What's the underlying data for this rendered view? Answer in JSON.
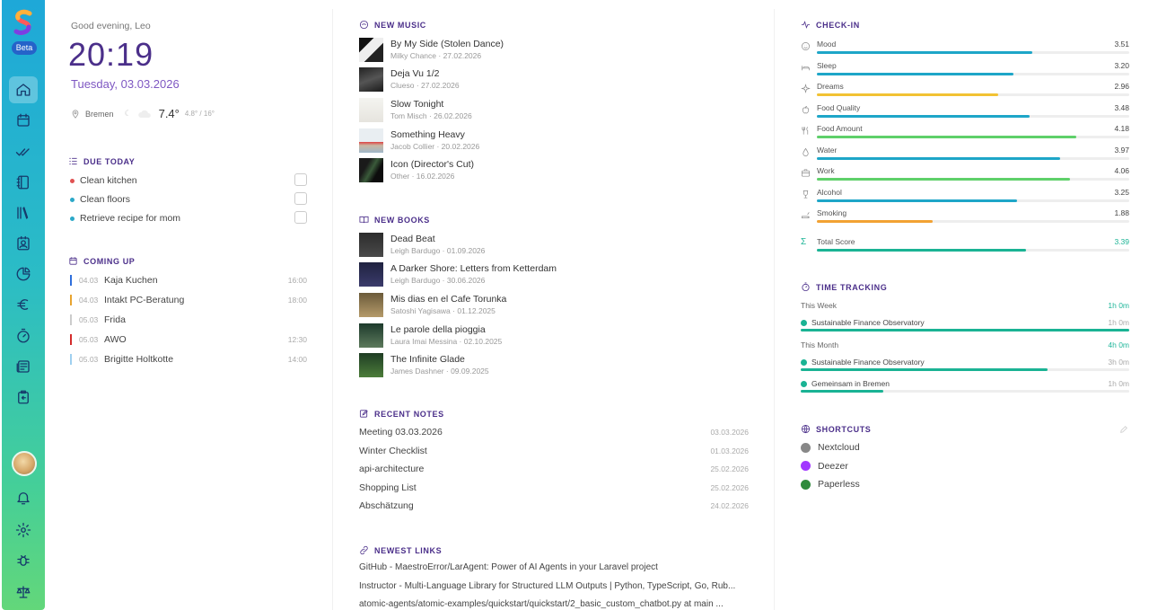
{
  "sidebar": {
    "beta": "Beta",
    "nav": [
      "home-icon",
      "calendar-icon",
      "double-check-icon",
      "notebook-icon",
      "library-icon",
      "contact-icon",
      "chart-icon",
      "euro-icon",
      "timer-icon",
      "news-icon",
      "clipboard-icon"
    ],
    "bottom": [
      "bell-icon",
      "gear-icon",
      "bug-icon",
      "scale-icon"
    ]
  },
  "header": {
    "greeting": "Good evening, Leo",
    "time": "20:19",
    "date": "Tuesday, 03.03.2026",
    "weather": {
      "city": "Bremen",
      "temp": "7.4°",
      "range": "4.8° / 16°"
    }
  },
  "due_today": {
    "title": "DUE TODAY",
    "tasks": [
      {
        "label": "Clean kitchen",
        "color": "#e05252"
      },
      {
        "label": "Clean floors",
        "color": "#2ba8c8"
      },
      {
        "label": "Retrieve recipe for mom",
        "color": "#2ba8c8"
      }
    ]
  },
  "coming_up": {
    "title": "COMING UP",
    "events": [
      {
        "date": "04.03",
        "label": "Kaja Kuchen",
        "time": "16:00",
        "color": "#2f6fdc"
      },
      {
        "date": "04.03",
        "label": "Intakt PC-Beratung",
        "time": "18:00",
        "color": "#e8a430"
      },
      {
        "date": "05.03",
        "label": "Frida",
        "time": "",
        "color": "#cccccc"
      },
      {
        "date": "05.03",
        "label": "AWO",
        "time": "12:30",
        "color": "#d42b2b"
      },
      {
        "date": "05.03",
        "label": "Brigitte Holtkotte",
        "time": "14:00",
        "color": "#9fd0f0"
      }
    ]
  },
  "new_music": {
    "title": "NEW MUSIC",
    "items": [
      {
        "name": "By My Side (Stolen Dance)",
        "sub": "Milky Chance · 27.02.2026"
      },
      {
        "name": "Deja Vu 1/2",
        "sub": "Clueso · 27.02.2026"
      },
      {
        "name": "Slow Tonight",
        "sub": "Tom Misch · 26.02.2026"
      },
      {
        "name": "Something Heavy",
        "sub": "Jacob Collier · 20.02.2026"
      },
      {
        "name": "Icon (Director's Cut)",
        "sub": "Other · 16.02.2026"
      }
    ]
  },
  "new_books": {
    "title": "NEW BOOKS",
    "items": [
      {
        "name": "Dead Beat",
        "sub": "Leigh Bardugo · 01.09.2026"
      },
      {
        "name": "A Darker Shore: Letters from Ketterdam",
        "sub": "Leigh Bardugo · 30.06.2026"
      },
      {
        "name": "Mis dias en el Cafe Torunka",
        "sub": "Satoshi Yagisawa · 01.12.2025"
      },
      {
        "name": "Le parole della pioggia",
        "sub": "Laura Imai Messina · 02.10.2025"
      },
      {
        "name": "The Infinite Glade",
        "sub": "James Dashner · 09.09.2025"
      }
    ]
  },
  "recent_notes": {
    "title": "RECENT NOTES",
    "items": [
      {
        "name": "Meeting 03.03.2026",
        "date": "03.03.2026"
      },
      {
        "name": "Winter Checklist",
        "date": "01.03.2026"
      },
      {
        "name": "api-architecture",
        "date": "25.02.2026"
      },
      {
        "name": "Shopping List",
        "date": "25.02.2026"
      },
      {
        "name": "Abschätzung",
        "date": "24.02.2026"
      }
    ]
  },
  "newest_links": {
    "title": "NEWEST LINKS",
    "items": [
      "GitHub - MaestroError/LarAgent: Power of AI Agents in your Laravel project",
      "Instructor - Multi-Language Library for Structured LLM Outputs | Python, TypeScript, Go, Rub...",
      "atomic-agents/atomic-examples/quickstart/quickstart/2_basic_custom_chatbot.py at main ..."
    ]
  },
  "checkin": {
    "title": "CHECK-IN",
    "items": [
      {
        "label": "Mood",
        "value": "3.51",
        "fraction": 0.69,
        "color": "#1ea6c8",
        "icon": "smile-icon"
      },
      {
        "label": "Sleep",
        "value": "3.20",
        "fraction": 0.63,
        "color": "#1ea6c8",
        "icon": "bed-icon"
      },
      {
        "label": "Dreams",
        "value": "2.96",
        "fraction": 0.58,
        "color": "#f2c233",
        "icon": "sparkle-icon"
      },
      {
        "label": "Food Quality",
        "value": "3.48",
        "fraction": 0.68,
        "color": "#1ea6c8",
        "icon": "apple-icon"
      },
      {
        "label": "Food Amount",
        "value": "4.18",
        "fraction": 0.83,
        "color": "#5fd06a",
        "icon": "utensils-icon"
      },
      {
        "label": "Water",
        "value": "3.97",
        "fraction": 0.78,
        "color": "#1ea6c8",
        "icon": "droplet-icon"
      },
      {
        "label": "Work",
        "value": "4.06",
        "fraction": 0.81,
        "color": "#5fd06a",
        "icon": "briefcase-icon"
      },
      {
        "label": "Alcohol",
        "value": "3.25",
        "fraction": 0.64,
        "color": "#1ea6c8",
        "icon": "glass-icon"
      },
      {
        "label": "Smoking",
        "value": "1.88",
        "fraction": 0.37,
        "color": "#f2a233",
        "icon": "cigarette-icon"
      }
    ],
    "total": {
      "label": "Total Score",
      "value": "3.39",
      "fraction": 0.67,
      "color": "#1ab394"
    }
  },
  "time_tracking": {
    "title": "TIME TRACKING",
    "week": {
      "label": "This Week",
      "total": "1h 0m",
      "rows": [
        {
          "label": "Sustainable Finance Observatory",
          "value": "1h 0m",
          "fraction": 1.0
        }
      ]
    },
    "month": {
      "label": "This Month",
      "total": "4h 0m",
      "rows": [
        {
          "label": "Sustainable Finance Observatory",
          "value": "3h 0m",
          "fraction": 0.75
        },
        {
          "label": "Gemeinsam in Bremen",
          "value": "1h 0m",
          "fraction": 0.25
        }
      ]
    }
  },
  "shortcuts": {
    "title": "SHORTCUTS",
    "items": [
      {
        "label": "Nextcloud",
        "color": "#888888"
      },
      {
        "label": "Deezer",
        "color": "#a238ff"
      },
      {
        "label": "Paperless",
        "color": "#2f8a3c"
      }
    ]
  }
}
